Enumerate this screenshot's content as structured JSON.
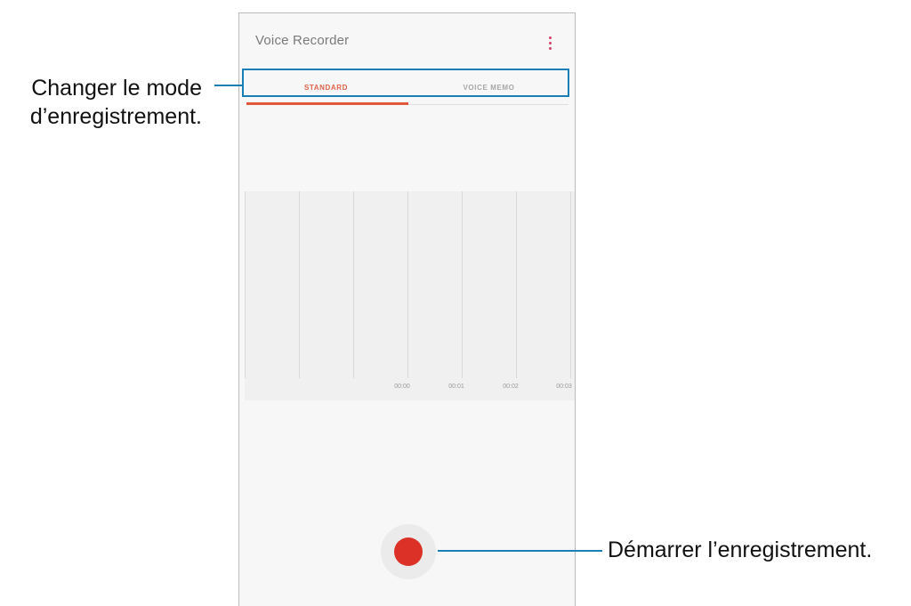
{
  "app": {
    "title": "Voice Recorder",
    "more_icon": "more-vertical-icon"
  },
  "tabs": [
    {
      "label": "STANDARD",
      "active": true
    },
    {
      "label": "VOICE MEMO",
      "active": false
    }
  ],
  "waveform": {
    "time_labels": [
      "00:00",
      "00:01",
      "00:02",
      "00:03"
    ]
  },
  "record_button": {
    "icon": "record-icon"
  },
  "annotations": {
    "mode_line1": "Changer le mode",
    "mode_line2": "d’enregistrement.",
    "start": "Démarrer l’enregistrement."
  },
  "colors": {
    "accent": "#e0573c",
    "record": "#dc3126",
    "callout": "#1a7fb5"
  }
}
